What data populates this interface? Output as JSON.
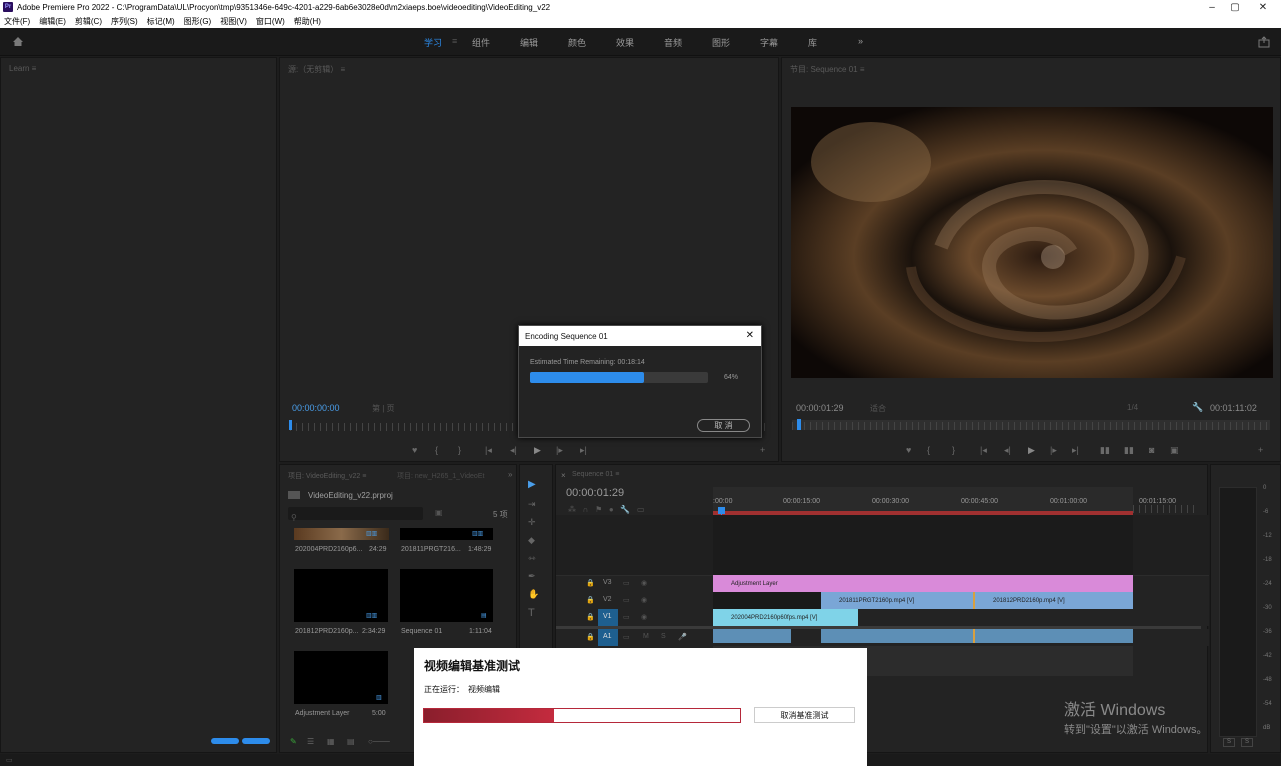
{
  "window": {
    "app_logo_text": "Pr",
    "title": "Adobe Premiere Pro 2022 - C:\\ProgramData\\UL\\Procyon\\tmp\\9351346e-649c-4201-a229-6ab6e3028e0d\\m2xiaeps.boe\\videoediting\\VideoEditing_v22",
    "controls": {
      "minimize": "–",
      "maximize": "▢",
      "close": "✕"
    }
  },
  "menu": [
    "文件(F)",
    "编辑(E)",
    "剪辑(C)",
    "序列(S)",
    "标记(M)",
    "图形(G)",
    "视图(V)",
    "窗口(W)",
    "帮助(H)"
  ],
  "workspaces": {
    "items": [
      "学习",
      "组件",
      "编辑",
      "颜色",
      "效果",
      "音频",
      "图形",
      "字幕",
      "库"
    ],
    "active": "学习",
    "more": "»"
  },
  "learn_panel": {
    "title": "Learn ≡"
  },
  "source_monitor": {
    "title": "源:（无剪辑） ≡",
    "timecode": "00:00:00:00",
    "zoom": "第 | 页"
  },
  "program_monitor": {
    "title": "节目: Sequence 01 ≡",
    "timecode": "00:00:01:29",
    "fit": "适合",
    "quality": "1/4",
    "duration": "00:01:11:02"
  },
  "project_panel": {
    "tab1": "项目: VideoEditing_v22 ≡",
    "tab2": "项目: new_H265_1_VideoEt",
    "more": "»",
    "project_file": "VideoEditing_v22.prproj",
    "item_count": "5 项",
    "items": [
      {
        "name": "202004PRD2160p6...",
        "duration": "24:29"
      },
      {
        "name": "201811PRGT216...",
        "duration": "1:48:29"
      },
      {
        "name": "201812PRD2160p...",
        "duration": "2:34:29"
      },
      {
        "name": "Sequence 01",
        "duration": "1:11:04"
      },
      {
        "name": "Adjustment Layer",
        "duration": "5:00"
      }
    ]
  },
  "timeline": {
    "tab": "Sequence 01 ≡",
    "close": "×",
    "timecode": "00:00:01:29",
    "ruler_labels": [
      ":00:00",
      "00:00:15:00",
      "00:00:30:00",
      "00:00:45:00",
      "00:01:00:00",
      "00:01:15:00"
    ],
    "tracks": [
      "V3",
      "V2",
      "V1",
      "A1"
    ],
    "clips": {
      "adjustment": "Adjustment Layer",
      "v2_a": "201811PRGT2160p.mp4 [V]",
      "v2_b": "201812PRD2160p.mp4 [V]",
      "v1": "202004PRD2160p60fps.mp4 [V]"
    }
  },
  "audio_meter": {
    "scale": [
      "0",
      "-6",
      "-12",
      "-18",
      "-24",
      "-30",
      "-36",
      "-42",
      "-48",
      "-54",
      "dB"
    ],
    "solo": "S"
  },
  "encoding_dialog": {
    "title": "Encoding Sequence 01",
    "close": "✕",
    "remaining_label": "Estimated Time Remaining: 00:18:14",
    "progress": 0.64,
    "progress_text": "64%",
    "cancel": "取 消"
  },
  "benchmark_dialog": {
    "title": "视频编辑基准测试",
    "running_label": "正在运行：",
    "running_value": "视频编辑",
    "progress": 0.41,
    "cancel": "取消基准测试"
  },
  "watermark": {
    "line1": "激活 Windows",
    "line2": "转到\"设置\"以激活 Windows。"
  },
  "colors": {
    "accent_blue": "#2d8ceb",
    "adjustment_clip": "#d98ad9",
    "video_clip": "#7aa6d6",
    "v1_clip": "#7fd3e8",
    "audio_clip": "#5d8fb6",
    "bench_progress": "#b5283a"
  }
}
